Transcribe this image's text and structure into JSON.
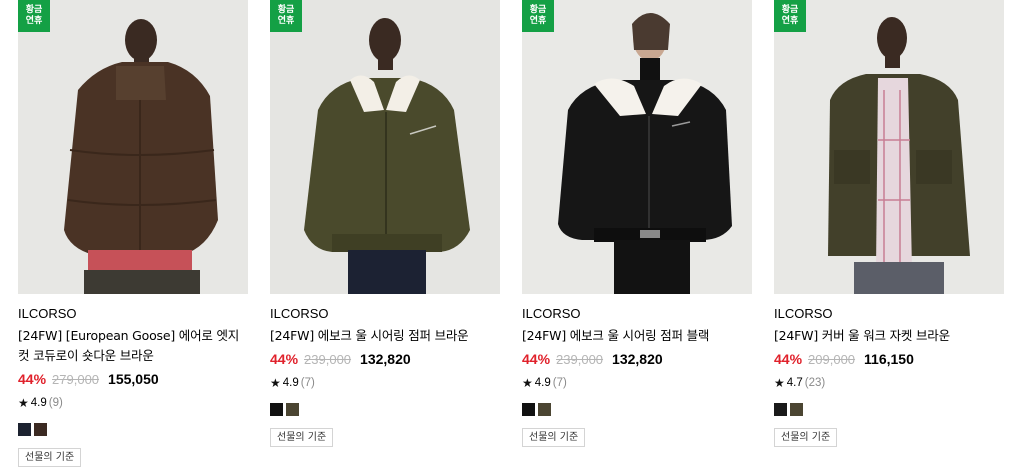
{
  "products": [
    {
      "badge": "황금\n연휴",
      "brand": "ILCORSO",
      "title_line1": "[24FW] [European Goose] 에어로 엣지",
      "title_line2": "컷 코듀로이 숏다운 브라운",
      "discount": "44%",
      "original_price": "279,000",
      "sale_price": "155,050",
      "rating": "4.9",
      "review_count": "(9)",
      "swatches": [
        "#1c2230",
        "#3b2a22"
      ],
      "gift_label": "선물의 기준",
      "image": "model-wearing-brown-corduroy-puffer-jacket"
    },
    {
      "badge": "황금\n연휴",
      "brand": "ILCORSO",
      "title_line1": "[24FW] 에보크 울 시어링 점퍼 브라운",
      "title_line2": "",
      "discount": "44%",
      "original_price": "239,000",
      "sale_price": "132,820",
      "rating": "4.9",
      "review_count": "(7)",
      "swatches": [
        "#111111",
        "#4b4532"
      ],
      "gift_label": "선물의 기준",
      "image": "model-wearing-olive-wool-shearling-bomber"
    },
    {
      "badge": "황금\n연휴",
      "brand": "ILCORSO",
      "title_line1": "[24FW] 에보크 울 시어링 점퍼 블랙",
      "title_line2": "",
      "discount": "44%",
      "original_price": "239,000",
      "sale_price": "132,820",
      "rating": "4.9",
      "review_count": "(7)",
      "swatches": [
        "#111111",
        "#4b4532"
      ],
      "gift_label": "선물의 기준",
      "image": "model-wearing-black-wool-shearling-bomber"
    },
    {
      "badge": "황금\n연휴",
      "brand": "ILCORSO",
      "title_line1": "[24FW] 커버 울 워크 자켓 브라운",
      "title_line2": "",
      "discount": "44%",
      "original_price": "209,000",
      "sale_price": "116,150",
      "rating": "4.7",
      "review_count": "(23)",
      "swatches": [
        "#1a1a1a",
        "#4b4532"
      ],
      "gift_label": "선물의 기준",
      "image": "model-wearing-olive-wool-work-jacket"
    }
  ],
  "colors": {
    "badge_green": "#14a045",
    "discount_red": "#e0212b"
  }
}
